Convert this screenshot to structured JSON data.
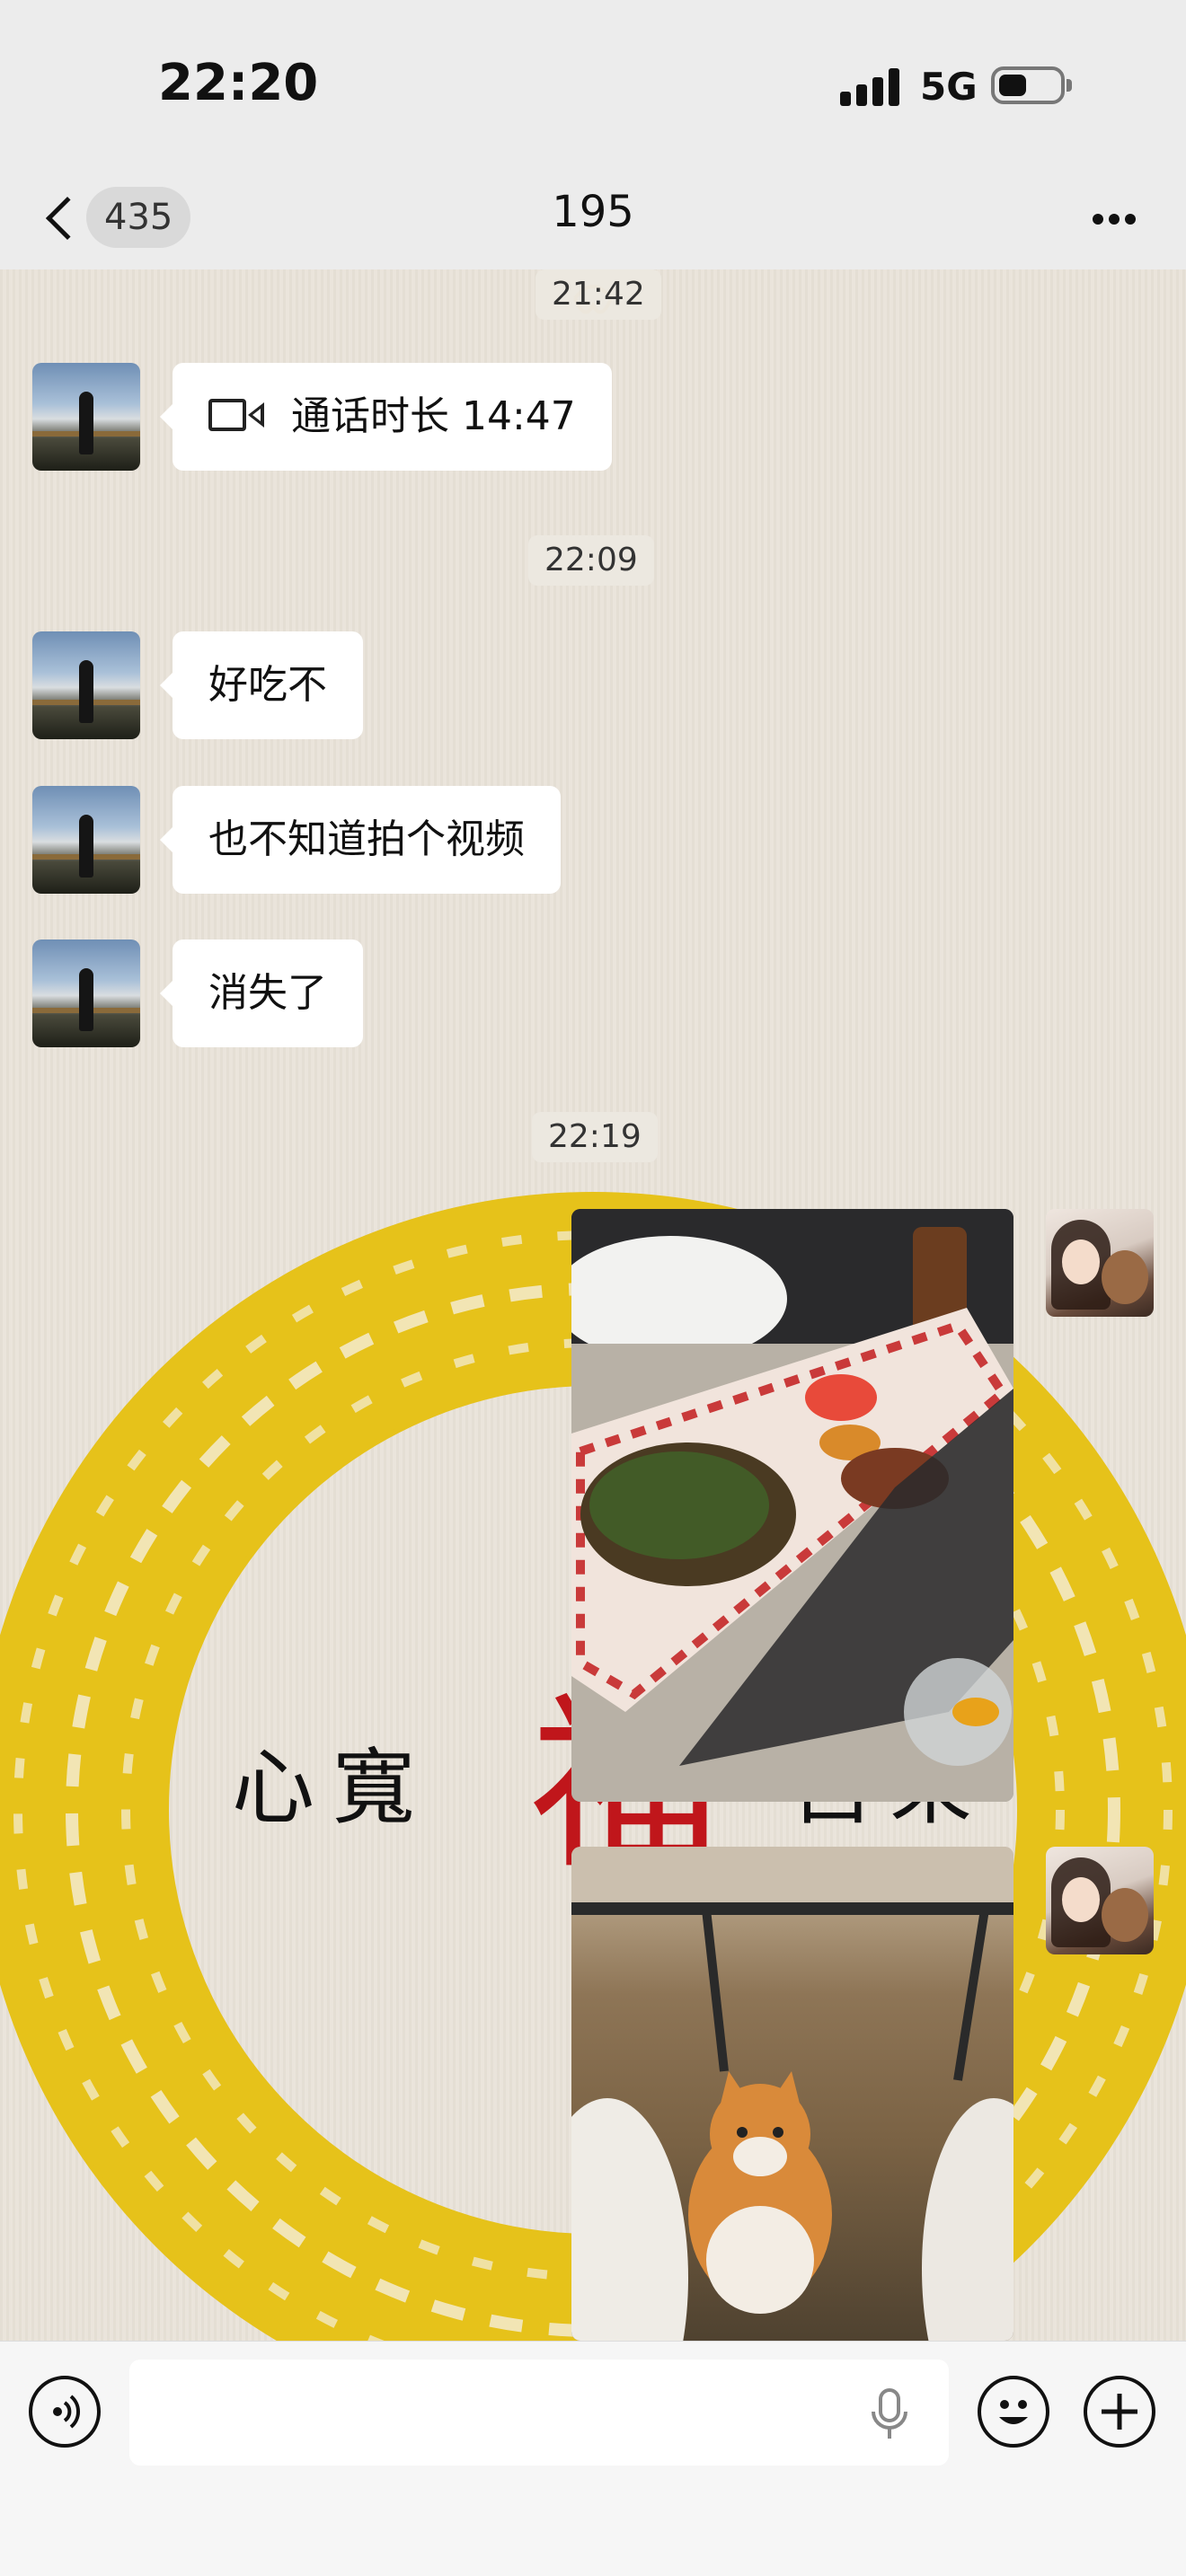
{
  "status_bar": {
    "time": "22:20",
    "network": "5G",
    "icons": [
      "signal-icon",
      "battery-icon"
    ]
  },
  "header": {
    "unread_count": "435",
    "title": "195",
    "icons": [
      "back-chevron-icon",
      "more-dots-icon"
    ]
  },
  "messages": [
    {
      "type": "timestamp",
      "text": "21:42"
    },
    {
      "type": "call",
      "sender": "contact",
      "text": "通话时长 14:47",
      "icon": "video-call-icon"
    },
    {
      "type": "timestamp",
      "text": "22:09"
    },
    {
      "type": "text",
      "sender": "contact",
      "text": "好吃不"
    },
    {
      "type": "text",
      "sender": "contact",
      "text": "也不知道拍个视频"
    },
    {
      "type": "text",
      "sender": "contact",
      "text": "消失了"
    },
    {
      "type": "timestamp",
      "text": "22:19"
    },
    {
      "type": "image",
      "sender": "me",
      "image": "food-photo"
    },
    {
      "type": "image",
      "sender": "me",
      "image": "cat-photo"
    }
  ],
  "wallpaper": {
    "chars": [
      "心",
      "寬",
      "福",
      "自",
      "來"
    ],
    "ring_color": "#e6c21a",
    "accent_color": "#c0161b"
  },
  "input_bar": {
    "placeholder": "",
    "icons": [
      "voice-mode-icon",
      "mic-icon",
      "emoji-icon",
      "plus-icon"
    ]
  }
}
